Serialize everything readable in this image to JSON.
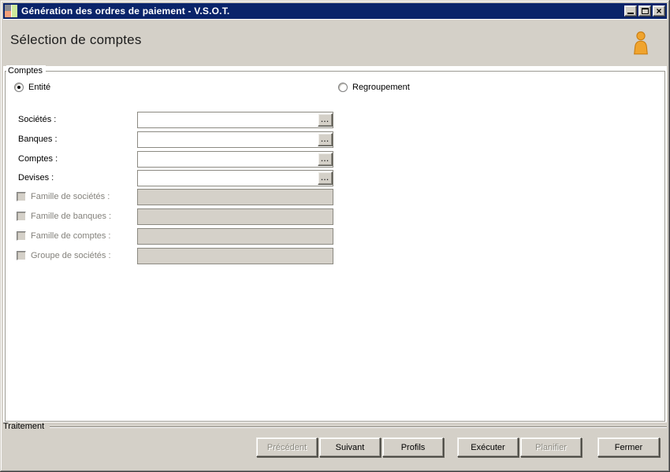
{
  "window": {
    "title": "Génération des ordres de paiement - V.S.O.T.",
    "controls": {
      "minimize": "minimize",
      "maximize": "maximize",
      "close": "close"
    }
  },
  "header": {
    "title": "Sélection de comptes",
    "icon": "user-person-icon"
  },
  "comptes": {
    "group_label": "Comptes",
    "radios": [
      {
        "label": "Entité",
        "selected": true
      },
      {
        "label": "Regroupement",
        "selected": false
      }
    ],
    "fields": [
      {
        "label": "Sociétés :",
        "value": "",
        "browse": "..."
      },
      {
        "label": "Banques :",
        "value": "",
        "browse": "..."
      },
      {
        "label": "Comptes :",
        "value": "",
        "browse": "..."
      },
      {
        "label": "Devises :",
        "value": "",
        "browse": "..."
      }
    ],
    "checkbox_fields": [
      {
        "label": "Famille de sociétés :",
        "checked": false,
        "value": "",
        "enabled": false
      },
      {
        "label": "Famille de banques :",
        "checked": false,
        "value": "",
        "enabled": false
      },
      {
        "label": "Famille de comptes :",
        "checked": false,
        "value": "",
        "enabled": false
      },
      {
        "label": "Groupe de sociétés :",
        "checked": false,
        "value": "",
        "enabled": false
      }
    ]
  },
  "footer": {
    "group_label": "Traitement",
    "buttons": [
      {
        "label": "Précédent",
        "enabled": false
      },
      {
        "label": "Suivant",
        "enabled": true
      },
      {
        "label": "Profils",
        "enabled": true
      },
      {
        "label": "Exécuter",
        "enabled": true
      },
      {
        "label": "Planifier",
        "enabled": false
      },
      {
        "label": "Fermer",
        "enabled": true
      }
    ]
  },
  "colors": {
    "titlebar_bg": "#0a246a",
    "window_bg": "#d4d0c8",
    "panel_bg": "#ffffff",
    "person_icon": "#f0a42e",
    "disabled_text": "#84827c"
  }
}
